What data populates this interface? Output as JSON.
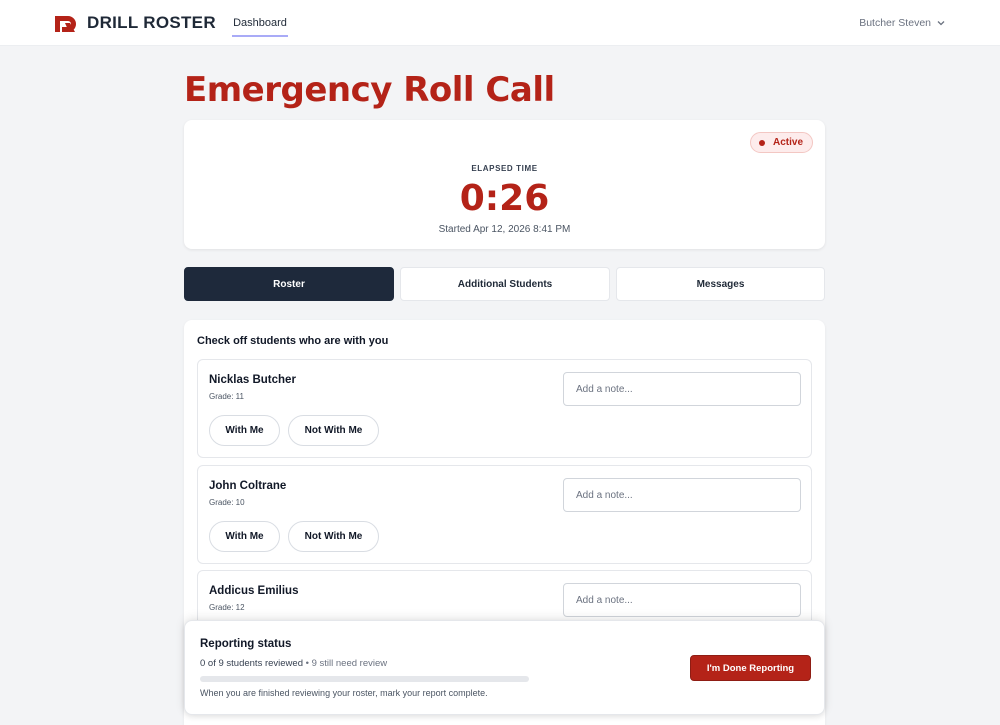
{
  "brand": {
    "name": "DRILL ROSTER",
    "accent": "#b42318"
  },
  "nav": {
    "tabs": [
      {
        "label": "Dashboard"
      }
    ]
  },
  "user": {
    "name": "Butcher Steven",
    "icon": "chevron-down-icon"
  },
  "page": {
    "title": "Emergency Roll Call"
  },
  "timer": {
    "status": "Active",
    "elapsed_label": "ELAPSED TIME",
    "elapsed_value": "0:26",
    "started": "Started Apr 12, 2026 8:41 PM"
  },
  "tabs": [
    {
      "label": "Roster",
      "active": true
    },
    {
      "label": "Additional Students",
      "active": false
    },
    {
      "label": "Messages",
      "active": false
    }
  ],
  "roster": {
    "heading": "Check off students who are with you",
    "note_placeholder": "Add a note...",
    "with_label": "With Me",
    "not_with_label": "Not With Me",
    "students": [
      {
        "name": "Nicklas Butcher",
        "grade": "Grade: 11"
      },
      {
        "name": "John Coltrane",
        "grade": "Grade: 10"
      },
      {
        "name": "Addicus Emilius",
        "grade": "Grade: 12"
      }
    ]
  },
  "reporting": {
    "title": "Reporting status",
    "reviewed": "0 of 9 students reviewed",
    "separator": "•",
    "remaining": "9 still need review",
    "progress": 0,
    "hint": "When you are finished reviewing your roster, mark your report complete.",
    "done_label": "I'm Done Reporting"
  }
}
